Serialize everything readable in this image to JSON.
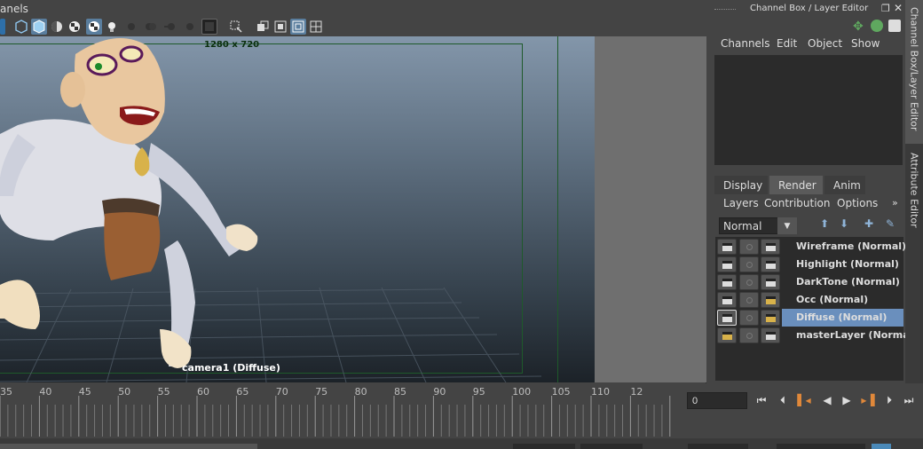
{
  "panel": {
    "menu_fragment": "anels"
  },
  "viewport": {
    "resolution_label": "1280 x 720",
    "camera_label": "camera1 (Diffuse)"
  },
  "timeline": {
    "ticks": [
      "35",
      "40",
      "45",
      "50",
      "55",
      "60",
      "65",
      "70",
      "75",
      "80",
      "85",
      "90",
      "95",
      "100",
      "105",
      "110",
      "12"
    ],
    "current_frame": "0"
  },
  "channel_box": {
    "title": "Channel Box / Layer Editor",
    "menus": [
      "Channels",
      "Edit",
      "Object",
      "Show"
    ]
  },
  "layer_editor": {
    "tabs": [
      "Display",
      "Render",
      "Anim"
    ],
    "active_tab": "Render",
    "menus": [
      "Layers",
      "Contribution",
      "Options"
    ],
    "blend_mode": "Normal",
    "layers": [
      {
        "name": "Wireframe (Normal)",
        "selected": false,
        "gold": false
      },
      {
        "name": "Highlight (Normal)",
        "selected": false,
        "gold": false
      },
      {
        "name": "DarkTone (Normal)",
        "selected": false,
        "gold": false
      },
      {
        "name": "Occ (Normal)",
        "selected": false,
        "gold": true
      },
      {
        "name": "Diffuse (Normal)",
        "selected": true,
        "gold": true
      },
      {
        "name": "masterLayer (Normal)",
        "selected": false,
        "gold": false
      }
    ]
  },
  "side_tabs": [
    "Channel Box/Layer Editor",
    "Attribute Editor"
  ],
  "colors": {
    "selection": "#6a8fbd",
    "gate_line": "#1e5a2a"
  }
}
